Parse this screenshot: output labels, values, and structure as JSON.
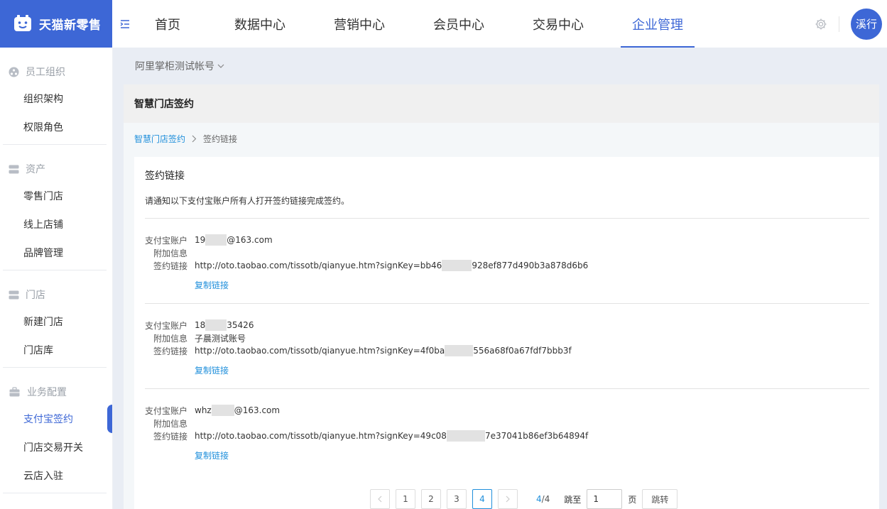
{
  "brand": {
    "title": "天猫新零售"
  },
  "nav": {
    "items": [
      {
        "label": "首页"
      },
      {
        "label": "数据中心"
      },
      {
        "label": "营销中心"
      },
      {
        "label": "会员中心"
      },
      {
        "label": "交易中心"
      },
      {
        "label": "企业管理",
        "active": true
      }
    ]
  },
  "user": {
    "avatar_text": "溪行"
  },
  "sidebar": {
    "groups": [
      {
        "title": "员工组织",
        "icon": "org-icon",
        "items": [
          "组织架构",
          "权限角色"
        ]
      },
      {
        "title": "资产",
        "icon": "database-icon",
        "items": [
          "零售门店",
          "线上店铺",
          "品牌管理"
        ]
      },
      {
        "title": "门店",
        "icon": "store-icon",
        "items": [
          "新建门店",
          "门店库"
        ]
      },
      {
        "title": "业务配置",
        "icon": "briefcase-icon",
        "items": [
          "支付宝签约",
          "门店交易开关",
          "云店入驻"
        ],
        "active_item": "支付宝签约"
      }
    ]
  },
  "main": {
    "account_switch": "阿里掌柜测试帐号",
    "card_title": "智慧门店签约",
    "breadcrumb": {
      "link": "智慧门店签约",
      "current": "签约链接"
    },
    "panel_title": "签约链接",
    "panel_desc": "请通知以下支付宝账户所有人打开签约链接完成签约。",
    "labels": {
      "account": "支付宝账户",
      "extra": "附加信息",
      "link": "签约链接",
      "copy": "复制链接"
    },
    "records": [
      {
        "account_prefix": "19",
        "account_suffix": "@163.com",
        "extra": "",
        "link_prefix": "http://oto.taobao.com/tissotb/qianyue.htm?signKey=bb46",
        "link_suffix": "928ef877d490b3a878d6b6"
      },
      {
        "account_prefix": "18",
        "account_suffix": "35426",
        "extra": "子晨测试账号",
        "link_prefix": "http://oto.taobao.com/tissotb/qianyue.htm?signKey=4f0ba",
        "link_suffix": "556a68f0a67fdf7bbb3f"
      },
      {
        "account_prefix": "whz",
        "account_suffix": "@163.com",
        "extra": "",
        "link_prefix": "http://oto.taobao.com/tissotb/qianyue.htm?signKey=49c08",
        "link_suffix": "7e37041b86ef3b64894f"
      }
    ]
  },
  "pager": {
    "pages": [
      "1",
      "2",
      "3",
      "4"
    ],
    "current": "4",
    "total": "4",
    "jump_label": "跳至",
    "jump_value": "1",
    "unit": "页",
    "go_label": "跳转"
  }
}
